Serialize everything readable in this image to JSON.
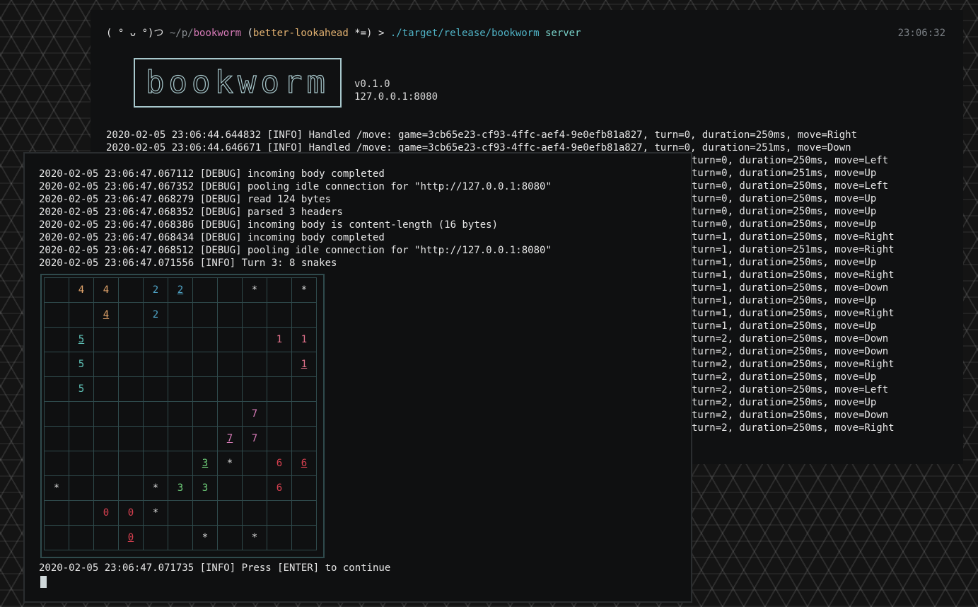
{
  "back_terminal": {
    "prompt": {
      "face": "( ° ᴗ °)つ",
      "path_prefix": "~/p/",
      "dir": "bookworm",
      "branch_open": "(",
      "branch": "better-lookahead",
      "branch_state": "*=)",
      "arrow": ">",
      "command": "./target/release/bookworm",
      "arg": "server"
    },
    "clock": "23:06:32",
    "logo_text": "bookworm",
    "version": "v0.1.0",
    "address": "127.0.0.1:8080",
    "log_first": [
      "2020-02-05 23:06:44.644832 [INFO] Handled /move: game=3cb65e23-cf93-4ffc-aef4-9e0efb81a827, turn=0, duration=250ms, move=Right",
      "2020-02-05 23:06:44.646671 [INFO] Handled /move: game=3cb65e23-cf93-4ffc-aef4-9e0efb81a827, turn=0, duration=251ms, move=Down"
    ],
    "log_visible_tail": [
      "turn=0, duration=250ms, move=Left",
      "turn=0, duration=251ms, move=Up",
      "turn=0, duration=250ms, move=Left",
      "turn=0, duration=250ms, move=Up",
      "turn=0, duration=250ms, move=Up",
      "turn=0, duration=250ms, move=Up",
      "turn=1, duration=250ms, move=Right",
      "turn=1, duration=251ms, move=Right",
      "turn=1, duration=250ms, move=Up",
      "turn=1, duration=250ms, move=Right",
      "turn=1, duration=250ms, move=Down",
      "turn=1, duration=250ms, move=Up",
      "turn=1, duration=250ms, move=Right",
      "turn=1, duration=250ms, move=Up",
      "turn=2, duration=250ms, move=Down",
      "turn=2, duration=250ms, move=Down",
      "turn=2, duration=250ms, move=Right",
      "turn=2, duration=250ms, move=Up",
      "turn=2, duration=250ms, move=Left",
      "turn=2, duration=250ms, move=Up",
      "turn=2, duration=250ms, move=Down",
      "turn=2, duration=250ms, move=Right"
    ]
  },
  "front_terminal": {
    "log": [
      "2020-02-05 23:06:47.067112 [DEBUG] incoming body completed",
      "2020-02-05 23:06:47.067352 [DEBUG] pooling idle connection for \"http://127.0.0.1:8080\"",
      "2020-02-05 23:06:47.068279 [DEBUG] read 124 bytes",
      "2020-02-05 23:06:47.068352 [DEBUG] parsed 3 headers",
      "2020-02-05 23:06:47.068386 [DEBUG] incoming body is content-length (16 bytes)",
      "2020-02-05 23:06:47.068434 [DEBUG] incoming body completed",
      "2020-02-05 23:06:47.068512 [DEBUG] pooling idle connection for \"http://127.0.0.1:8080\"",
      "2020-02-05 23:06:47.071556 [INFO] Turn 3: 8 snakes"
    ],
    "board": [
      [
        "",
        "4",
        "4",
        "",
        "2",
        "2u",
        "",
        "",
        "*",
        "",
        "*"
      ],
      [
        "",
        "",
        "4u",
        "",
        "2",
        "",
        "",
        "",
        "",
        "",
        ""
      ],
      [
        "",
        "5u",
        "",
        "",
        "",
        "",
        "",
        "",
        "",
        "1",
        "1"
      ],
      [
        "",
        "5",
        "",
        "",
        "",
        "",
        "",
        "",
        "",
        "",
        "1u"
      ],
      [
        "",
        "5",
        "",
        "",
        "",
        "",
        "",
        "",
        "",
        "",
        ""
      ],
      [
        "",
        "",
        "",
        "",
        "",
        "",
        "",
        "",
        "7",
        "",
        ""
      ],
      [
        "",
        "",
        "",
        "",
        "",
        "",
        "",
        "7u",
        "7",
        "",
        ""
      ],
      [
        "",
        "",
        "",
        "",
        "",
        "",
        "3u",
        "*",
        "",
        "6",
        "6u"
      ],
      [
        "*",
        "",
        "",
        "",
        "*",
        "3",
        "3",
        "",
        "",
        "6",
        ""
      ],
      [
        "",
        "",
        "0",
        "0",
        "*",
        "",
        "",
        "",
        "",
        "",
        ""
      ],
      [
        "",
        "",
        "",
        "0u",
        "",
        "",
        "*",
        "",
        "*",
        "",
        ""
      ]
    ],
    "footer": "2020-02-05 23:06:47.071735 [INFO] Press [ENTER] to continue"
  },
  "colors": {
    "snake_0": "#d84050",
    "snake_1": "#e0708a",
    "snake_2": "#4fa3c6",
    "snake_3": "#6fcf7a",
    "snake_4": "#e2a46b",
    "snake_5": "#5fc3b8",
    "snake_6": "#d84050",
    "snake_7": "#d77bb8",
    "accent_cyan": "#4fb3c6",
    "accent_pink": "#d77bb8"
  }
}
